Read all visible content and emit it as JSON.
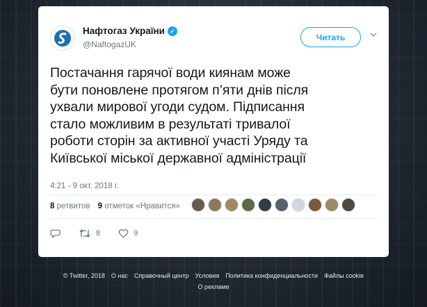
{
  "author": {
    "name": "Нафтогаз України",
    "handle": "@NaftogazUK",
    "follow_label": "Читать"
  },
  "tweet": {
    "lines": [
      "Постачання гарячої води киянам може",
      "бути поновлене протягом п’яти днів після",
      "ухвали мирової угоди судом. Підписання",
      "стало можливим в результаті тривалої",
      "роботи сторін за активної участі Уряду та",
      "Київської міської державної адміністрації"
    ],
    "timestamp": "4:21 - 9 окт. 2018 г."
  },
  "stats": {
    "retweets_count": "8",
    "retweets_label": "ретвитов",
    "likes_count": "9",
    "likes_label": "отметок «Нравится»"
  },
  "likers_colors": [
    "#6b5a48",
    "#8c7a5e",
    "#a08a60",
    "#5b6b4a",
    "#2f3b45",
    "#556070",
    "#d0d7de",
    "#7a5a3a",
    "#9a8a6a",
    "#4d4a40"
  ],
  "actions": {
    "reply_icon": "reply-icon",
    "retweet_icon": "retweet-icon",
    "retweet_count": "8",
    "like_icon": "heart-icon",
    "like_count": "9"
  },
  "footer": {
    "links": [
      "© Twitter, 2018",
      "О нас",
      "Справочный центр",
      "Условия",
      "Политика конфиденциальности",
      "Файлы cookie"
    ],
    "links_row2": [
      "О рекламе"
    ]
  },
  "colors": {
    "accent": "#1da1f2",
    "text": "#14171a",
    "muted": "#657786"
  }
}
